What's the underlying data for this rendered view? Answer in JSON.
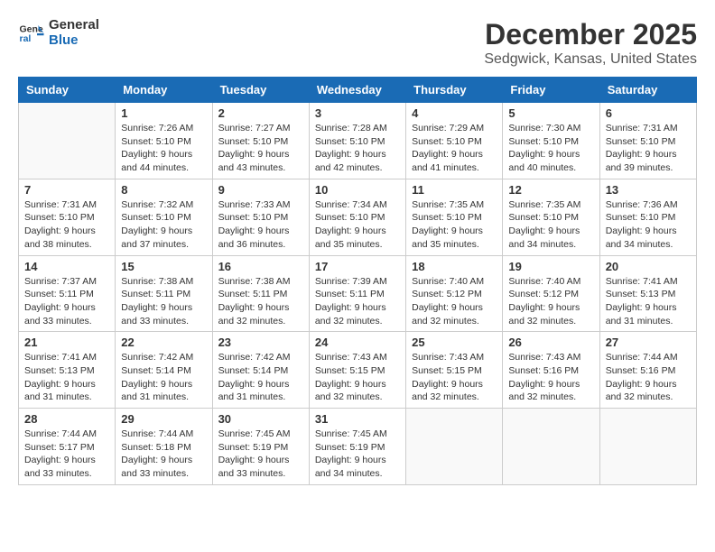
{
  "logo": {
    "line1": "General",
    "line2": "Blue"
  },
  "title": "December 2025",
  "subtitle": "Sedgwick, Kansas, United States",
  "days_of_week": [
    "Sunday",
    "Monday",
    "Tuesday",
    "Wednesday",
    "Thursday",
    "Friday",
    "Saturday"
  ],
  "weeks": [
    [
      {
        "day": "",
        "info": ""
      },
      {
        "day": "1",
        "info": "Sunrise: 7:26 AM\nSunset: 5:10 PM\nDaylight: 9 hours\nand 44 minutes."
      },
      {
        "day": "2",
        "info": "Sunrise: 7:27 AM\nSunset: 5:10 PM\nDaylight: 9 hours\nand 43 minutes."
      },
      {
        "day": "3",
        "info": "Sunrise: 7:28 AM\nSunset: 5:10 PM\nDaylight: 9 hours\nand 42 minutes."
      },
      {
        "day": "4",
        "info": "Sunrise: 7:29 AM\nSunset: 5:10 PM\nDaylight: 9 hours\nand 41 minutes."
      },
      {
        "day": "5",
        "info": "Sunrise: 7:30 AM\nSunset: 5:10 PM\nDaylight: 9 hours\nand 40 minutes."
      },
      {
        "day": "6",
        "info": "Sunrise: 7:31 AM\nSunset: 5:10 PM\nDaylight: 9 hours\nand 39 minutes."
      }
    ],
    [
      {
        "day": "7",
        "info": "Sunrise: 7:31 AM\nSunset: 5:10 PM\nDaylight: 9 hours\nand 38 minutes."
      },
      {
        "day": "8",
        "info": "Sunrise: 7:32 AM\nSunset: 5:10 PM\nDaylight: 9 hours\nand 37 minutes."
      },
      {
        "day": "9",
        "info": "Sunrise: 7:33 AM\nSunset: 5:10 PM\nDaylight: 9 hours\nand 36 minutes."
      },
      {
        "day": "10",
        "info": "Sunrise: 7:34 AM\nSunset: 5:10 PM\nDaylight: 9 hours\nand 35 minutes."
      },
      {
        "day": "11",
        "info": "Sunrise: 7:35 AM\nSunset: 5:10 PM\nDaylight: 9 hours\nand 35 minutes."
      },
      {
        "day": "12",
        "info": "Sunrise: 7:35 AM\nSunset: 5:10 PM\nDaylight: 9 hours\nand 34 minutes."
      },
      {
        "day": "13",
        "info": "Sunrise: 7:36 AM\nSunset: 5:10 PM\nDaylight: 9 hours\nand 34 minutes."
      }
    ],
    [
      {
        "day": "14",
        "info": "Sunrise: 7:37 AM\nSunset: 5:11 PM\nDaylight: 9 hours\nand 33 minutes."
      },
      {
        "day": "15",
        "info": "Sunrise: 7:38 AM\nSunset: 5:11 PM\nDaylight: 9 hours\nand 33 minutes."
      },
      {
        "day": "16",
        "info": "Sunrise: 7:38 AM\nSunset: 5:11 PM\nDaylight: 9 hours\nand 32 minutes."
      },
      {
        "day": "17",
        "info": "Sunrise: 7:39 AM\nSunset: 5:11 PM\nDaylight: 9 hours\nand 32 minutes."
      },
      {
        "day": "18",
        "info": "Sunrise: 7:40 AM\nSunset: 5:12 PM\nDaylight: 9 hours\nand 32 minutes."
      },
      {
        "day": "19",
        "info": "Sunrise: 7:40 AM\nSunset: 5:12 PM\nDaylight: 9 hours\nand 32 minutes."
      },
      {
        "day": "20",
        "info": "Sunrise: 7:41 AM\nSunset: 5:13 PM\nDaylight: 9 hours\nand 31 minutes."
      }
    ],
    [
      {
        "day": "21",
        "info": "Sunrise: 7:41 AM\nSunset: 5:13 PM\nDaylight: 9 hours\nand 31 minutes."
      },
      {
        "day": "22",
        "info": "Sunrise: 7:42 AM\nSunset: 5:14 PM\nDaylight: 9 hours\nand 31 minutes."
      },
      {
        "day": "23",
        "info": "Sunrise: 7:42 AM\nSunset: 5:14 PM\nDaylight: 9 hours\nand 31 minutes."
      },
      {
        "day": "24",
        "info": "Sunrise: 7:43 AM\nSunset: 5:15 PM\nDaylight: 9 hours\nand 32 minutes."
      },
      {
        "day": "25",
        "info": "Sunrise: 7:43 AM\nSunset: 5:15 PM\nDaylight: 9 hours\nand 32 minutes."
      },
      {
        "day": "26",
        "info": "Sunrise: 7:43 AM\nSunset: 5:16 PM\nDaylight: 9 hours\nand 32 minutes."
      },
      {
        "day": "27",
        "info": "Sunrise: 7:44 AM\nSunset: 5:16 PM\nDaylight: 9 hours\nand 32 minutes."
      }
    ],
    [
      {
        "day": "28",
        "info": "Sunrise: 7:44 AM\nSunset: 5:17 PM\nDaylight: 9 hours\nand 33 minutes."
      },
      {
        "day": "29",
        "info": "Sunrise: 7:44 AM\nSunset: 5:18 PM\nDaylight: 9 hours\nand 33 minutes."
      },
      {
        "day": "30",
        "info": "Sunrise: 7:45 AM\nSunset: 5:19 PM\nDaylight: 9 hours\nand 33 minutes."
      },
      {
        "day": "31",
        "info": "Sunrise: 7:45 AM\nSunset: 5:19 PM\nDaylight: 9 hours\nand 34 minutes."
      },
      {
        "day": "",
        "info": ""
      },
      {
        "day": "",
        "info": ""
      },
      {
        "day": "",
        "info": ""
      }
    ]
  ]
}
